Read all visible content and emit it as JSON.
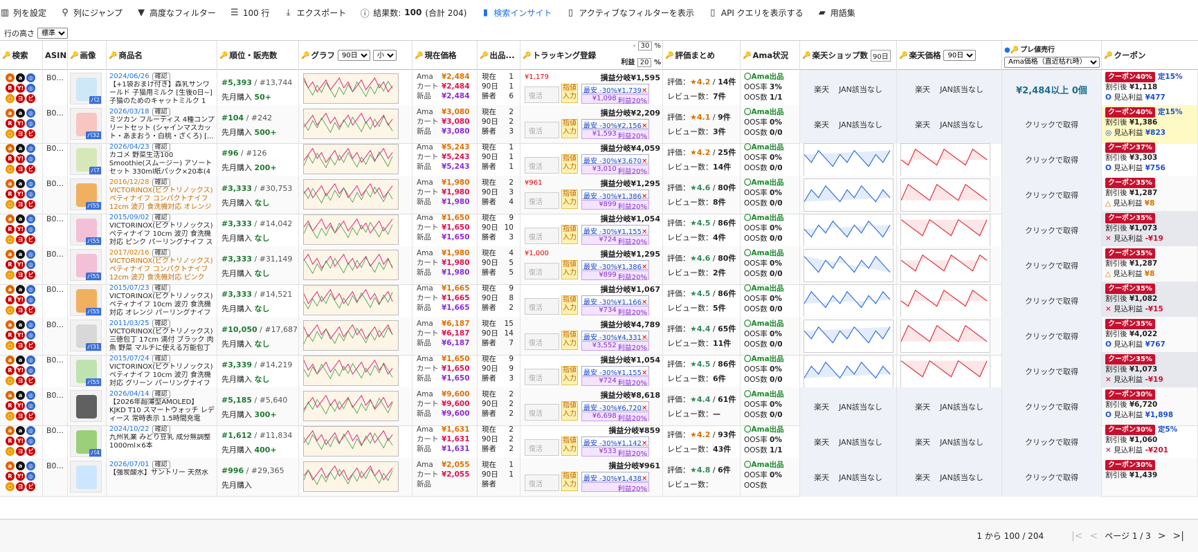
{
  "toolbar": {
    "set_columns": "列を設定",
    "jump_column": "列にジャンプ",
    "advanced_filter": "高度なフィルター",
    "rows_label": "100 行",
    "export": "エクスポート",
    "results_prefix": "結果数: ",
    "results_count": "100",
    "results_total": " (合計 204)",
    "search_insight": "検索インサイト",
    "active_filter": "アクティブなフィルターを表示",
    "api_query": "API クエリを表示する",
    "glossary": "用語集"
  },
  "row_height": {
    "label": "行の高さ",
    "value": "標準"
  },
  "header": {
    "search": "検索",
    "asin": "ASIN",
    "image": "画像",
    "name": "商品名",
    "rank": "順位・販売数",
    "graph": "グラフ",
    "graph_range": "90日",
    "graph_size": "小",
    "price": "現在価格",
    "sellers": "出品...",
    "tracking": "トラッキング登録",
    "track_pct": "30",
    "profit": "利益",
    "profit_pct": "20",
    "review": "評価まとめ",
    "ama": "Ama状況",
    "rakuten_shop": "楽天ショップ数",
    "rakuten_shop_range": "90日",
    "rakuten_price": "楽天価格",
    "rakuten_price_range": "90日",
    "premium": "プレ値売行",
    "premium_select": "Ama価格（直近枯れ時）",
    "coupon": "クーポン"
  },
  "labels": {
    "ama": "Ama",
    "cart": "カート",
    "new": "新品",
    "now": "現在",
    "d90": "90日",
    "winner": "勝者",
    "revive": "復活",
    "limit_in": "指値入力",
    "breakeven": "損益分岐",
    "lowest": "最安 -30%",
    "profit20": "利益20%",
    "review_eval": "評価：",
    "review_count": "レビュー数：",
    "ama_listed": "〇Ama出品",
    "oos_rate": "OOS率",
    "oos_count": "OOS数",
    "rakuten": "楽天",
    "jan_none": "JAN該当なし",
    "click_get": "クリックで取得",
    "first_buy": "先月購入",
    "coupon_after": "割引後",
    "expected": "見込利益",
    "confirm": "確認"
  },
  "rows": [
    {
      "asin": "B0...",
      "date": "2024/06/26",
      "title": "【+1袋おまけ付き】森乳サンワールド 子猫用ミルク [生後0日~] 子猫のためのキャットミルク 1袋...",
      "img_price": "パ2",
      "rank": "#5,393",
      "rank_total": "/ #13,744",
      "first_buy": "50+",
      "p_ama": "¥2,484",
      "p_cart": "¥2,484",
      "p_new": "¥2,484",
      "s_now": "1",
      "s_90": "1",
      "s_win": "6",
      "track_in": "¥1,179",
      "be": "¥1,595",
      "lowest": "¥1,739",
      "profit": "¥1,098",
      "stars": "4.2",
      "rev_n": "14件",
      "rev_c": "7件",
      "oos_rate": "3%",
      "oos_n": "1/1",
      "premium": "¥2,484以上 0個",
      "coupon": "クーポン40%",
      "tei": "定15%",
      "after": "¥1,118",
      "exp": "¥477",
      "exp_mark": "O",
      "exp_cls": "pos"
    },
    {
      "asin": "B0...",
      "date": "2026/03/18",
      "title": "ミツカン フルーティス 4種コンプリートセット (シャインマスカット・あまおう・白桃・ざくろ) [...",
      "img_price": "パ32",
      "rank": "#104",
      "rank_total": "/ #242",
      "first_buy": "500+",
      "p_ama": "¥3,080",
      "p_cart": "¥3,080",
      "p_new": "¥3,080",
      "s_now": "2",
      "s_90": "2",
      "s_win": "3",
      "track_in": "",
      "be": "¥2,209",
      "lowest": "¥2,156",
      "profit": "¥1,593",
      "stars": "4.1",
      "rev_n": "9件",
      "rev_c": "3件",
      "oos_rate": "0%",
      "oos_n": "0/0",
      "premium": "クリックで取得",
      "coupon": "クーポン40%",
      "tei": "定15%",
      "after": "¥1,386",
      "exp": "¥823",
      "exp_mark": "◎",
      "exp_cls": "pos"
    },
    {
      "asin": "B0...",
      "date": "2026/04/23",
      "title": "カゴメ 野菜生活100 Smoothie(スムージー) アソートセット 330ml紙パック×20本(4種×各5本)【EC限定...",
      "img_price": "パ7",
      "rank": "#96",
      "rank_total": "/ #126",
      "first_buy": "200+",
      "p_ama": "¥5,243",
      "p_cart": "¥5,243",
      "p_new": "¥5,243",
      "s_now": "1",
      "s_90": "1",
      "s_win": "1",
      "track_in": "",
      "be": "¥4,059",
      "lowest": "¥3,670",
      "profit": "¥3,010",
      "stars": "4.2",
      "rev_n": "25件",
      "rev_c": "14件",
      "oos_rate": "0%",
      "oos_n": "0/0",
      "premium": "クリックで取得",
      "coupon": "クーポン37%",
      "tei": "",
      "after": "¥3,303",
      "exp": "¥756",
      "exp_mark": "O",
      "exp_cls": "pos"
    },
    {
      "asin": "B0...",
      "date": "2016/12/28",
      "title": "VICTORINOX(ビクトリノックス) ペティナイフ コンパクトナイフ 12cm 波刃 食洗機対応 オレンジ ...",
      "img_price": "パ55",
      "rank": "#3,333",
      "rank_total": "/ #30,753",
      "first_buy": "なし",
      "p_ama": "¥1,980",
      "p_cart": "¥1,980",
      "p_new": "¥1,980",
      "s_now": "2",
      "s_90": "3",
      "s_win": "4",
      "track_in": "¥961",
      "be": "¥1,295",
      "lowest": "¥1,386",
      "profit": "¥899",
      "stars": "4.6",
      "rev_n": "80件",
      "rev_c": "8件",
      "oos_rate": "0%",
      "oos_n": "0/0",
      "premium": "クリックで取得",
      "coupon": "クーポン35%",
      "tei": "",
      "after": "¥1,287",
      "exp": "¥8",
      "exp_mark": "△",
      "exp_cls": "mid"
    },
    {
      "asin": "B0...",
      "date": "2015/09/02",
      "title": "VICTORINOX(ビクトリノックス) ペティナイフ 10cm 波刃 食洗機対応 ピンク パーリングナイフ スイス...",
      "img_price": "パ55",
      "rank": "#3,333",
      "rank_total": "/ #14,042",
      "first_buy": "なし",
      "p_ama": "¥1,650",
      "p_cart": "¥1,650",
      "p_new": "¥1,650",
      "s_now": "9",
      "s_90": "10",
      "s_win": "3",
      "track_in": "",
      "be": "¥1,054",
      "lowest": "¥1,155",
      "profit": "¥724",
      "stars": "4.5",
      "rev_n": "86件",
      "rev_c": "4件",
      "oos_rate": "0%",
      "oos_n": "0/0",
      "premium": "クリックで取得",
      "coupon": "クーポン35%",
      "tei": "",
      "after": "¥1,073",
      "exp": "-¥19",
      "exp_mark": "✕",
      "exp_cls": "neg"
    },
    {
      "asin": "B0...",
      "date": "2017/02/16",
      "title": "VICTORINOX(ビクトリノックス) ペティナイフ コンパクトナイフ 12cm 波刃 食洗機対応 ピンク ス...",
      "img_price": "パ55",
      "rank": "#3,333",
      "rank_total": "/ #31,149",
      "first_buy": "なし",
      "p_ama": "¥1,980",
      "p_cart": "¥1,980",
      "p_new": "¥1,980",
      "s_now": "4",
      "s_90": "5",
      "s_win": "5",
      "track_in": "¥1,000",
      "be": "¥1,295",
      "lowest": "¥1,386",
      "profit": "¥899",
      "stars": "4.6",
      "rev_n": "80件",
      "rev_c": "2件",
      "oos_rate": "0%",
      "oos_n": "0/0",
      "premium": "クリックで取得",
      "coupon": "クーポン35%",
      "tei": "",
      "after": "¥1,287",
      "exp": "¥8",
      "exp_mark": "△",
      "exp_cls": "mid"
    },
    {
      "asin": "B0...",
      "date": "2015/07/23",
      "title": "VICTORINOX(ビクトリノックス) ペティナイフ 10cm 波刃 食洗機対応 オレンジ パーリングナイフ スイ...",
      "img_price": "パ55",
      "rank": "#3,333",
      "rank_total": "/ #14,521",
      "first_buy": "なし",
      "p_ama": "¥1,665",
      "p_cart": "¥1,665",
      "p_new": "¥1,665",
      "s_now": "9",
      "s_90": "8",
      "s_win": "2",
      "track_in": "",
      "be": "¥1,067",
      "lowest": "¥1,166",
      "profit": "¥734",
      "stars": "4.5",
      "rev_n": "86件",
      "rev_c": "5件",
      "oos_rate": "0%",
      "oos_n": "0/0",
      "premium": "クリックで取得",
      "coupon": "クーポン35%",
      "tei": "",
      "after": "¥1,082",
      "exp": "-¥15",
      "exp_mark": "✕",
      "exp_cls": "neg"
    },
    {
      "asin": "B0...",
      "date": "2011/03/25",
      "title": "VICTORINOX(ビクトリノックス) 三徳包丁 17cm 満付 ブラック 肉 魚 野菜 マルチに使える万能包丁 人...",
      "img_price": "パ31",
      "rank": "#10,050",
      "rank_total": "/ #17,687",
      "first_buy": "なし",
      "p_ama": "¥6,187",
      "p_cart": "¥6,187",
      "p_new": "¥6,187",
      "s_now": "15",
      "s_90": "14",
      "s_win": "7",
      "track_in": "",
      "be": "¥4,789",
      "lowest": "¥4,331",
      "profit": "¥3,552",
      "stars": "4.4",
      "rev_n": "65件",
      "rev_c": "11件",
      "oos_rate": "0%",
      "oos_n": "0/0",
      "premium": "クリックで取得",
      "coupon": "クーポン35%",
      "tei": "",
      "after": "¥4,022",
      "exp": "¥767",
      "exp_mark": "O",
      "exp_cls": "pos"
    },
    {
      "asin": "B0...",
      "date": "2015/07/24",
      "title": "VICTORINOX(ビクトリノックス) ペティナイフ 10cm 波刃 食洗機対応 グリーン パーリングナイフ スイ...",
      "img_price": "パ55",
      "rank": "#3,339",
      "rank_total": "/ #14,219",
      "first_buy": "なし",
      "p_ama": "¥1,650",
      "p_cart": "¥1,650",
      "p_new": "¥1,650",
      "s_now": "9",
      "s_90": "9",
      "s_win": "3",
      "track_in": "",
      "be": "¥1,054",
      "lowest": "¥1,155",
      "profit": "¥724",
      "stars": "4.5",
      "rev_n": "86件",
      "rev_c": "6件",
      "oos_rate": "0%",
      "oos_n": "0/0",
      "premium": "クリックで取得",
      "coupon": "クーポン35%",
      "tei": "",
      "after": "¥1,073",
      "exp": "-¥19",
      "exp_mark": "✕",
      "exp_cls": "neg"
    },
    {
      "asin": "B0...",
      "date": "2026/04/14",
      "title": "【2026年超薄型AMOLED】KJKD T10 スマートウォッチ レディース 常時表示 1.5時間充電 iPhone/ア...",
      "img_price": "",
      "rank": "#5,185",
      "rank_total": "/ #5,640",
      "first_buy": "300+",
      "p_ama": "¥9,600",
      "p_cart": "¥9,600",
      "p_new": "¥9,600",
      "s_now": "2",
      "s_90": "2",
      "s_win": "2",
      "track_in": "",
      "be": "¥8,618",
      "lowest": "¥6,720",
      "profit": "¥6,698",
      "stars": "4.4",
      "rev_n": "61件",
      "rev_c": "—",
      "oos_rate": "0%",
      "oos_n": "0/0",
      "premium": "クリックで取得",
      "coupon": "クーポン30%",
      "tei": "",
      "after": "¥6,720",
      "exp": "¥1,898",
      "exp_mark": "O",
      "exp_cls": "pos"
    },
    {
      "asin": "B0...",
      "date": "2024/10/22",
      "title": "九州乳業 みどり豆乳 成分無調整 1000ml×6本",
      "img_price": "パ4",
      "rank": "#1,612",
      "rank_total": "/ #11,834",
      "first_buy": "400+",
      "p_ama": "¥1,631",
      "p_cart": "¥1,631",
      "p_new": "¥1,631",
      "s_now": "2",
      "s_90": "2",
      "s_win": "2",
      "track_in": "",
      "be": "¥859",
      "lowest": "¥1,142",
      "profit": "¥533",
      "stars": "4.2",
      "rev_n": "93件",
      "rev_c": "43件",
      "oos_rate": "0%",
      "oos_n": "1/1",
      "premium": "クリックで取得",
      "coupon": "クーポン30%",
      "tei": "定5%",
      "after": "¥1,060",
      "exp": "-¥201",
      "exp_mark": "✕",
      "exp_cls": "neg"
    },
    {
      "asin": "B0...",
      "date": "2026/07/01",
      "title": "【強炭酸水】サントリー 天然水",
      "img_price": "",
      "rank": "#996",
      "rank_total": "/ #29,365",
      "first_buy": "",
      "p_ama": "¥2,055",
      "p_cart": "¥2,055",
      "p_new": "",
      "s_now": "1",
      "s_90": "1",
      "s_win": "",
      "track_in": "",
      "be": "¥961",
      "lowest": "¥1,438",
      "profit": "",
      "stars": "4.8",
      "rev_n": "6件",
      "rev_c": "",
      "oos_rate": "0%",
      "oos_n": "",
      "premium": "クリックで取得",
      "coupon": "クーポン30%",
      "tei": "",
      "after": "¥1,439",
      "exp": "",
      "exp_mark": "",
      "exp_cls": "pos"
    }
  ],
  "footer": {
    "range": "1 から 100 / 204",
    "page": "ページ 1 / 3"
  }
}
